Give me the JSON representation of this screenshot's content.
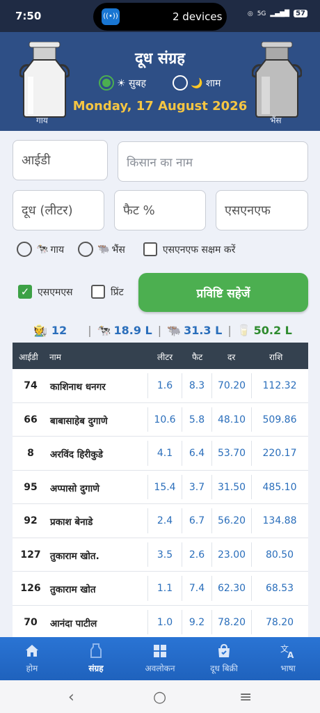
{
  "status_bar": {
    "time": "7:50",
    "devices": "2 devices",
    "battery": "57",
    "net": "5G"
  },
  "header": {
    "title": "दूध संग्रह",
    "left_can_label": "गाय",
    "right_can_label": "भैंस",
    "shift_morning": "☀ सुबह",
    "shift_evening": "🌙 शाम",
    "selected_shift": "morning",
    "date": "Monday, 17 August 2026"
  },
  "form": {
    "id_placeholder": "आईडी",
    "farmer_name_placeholder": "किसान का नाम",
    "milk_placeholder": "दूध (लीटर)",
    "fat_placeholder": "फैट %",
    "snf_placeholder": "एसएनएफ",
    "cow_label": "गाय",
    "buffalo_label": "भैंस",
    "enable_snf_label": "एसएनएफ सक्षम करें",
    "sms_label": "एसएमएस",
    "sms_checked": true,
    "print_label": "प्रिंट",
    "print_checked": false,
    "save_button": "प्रविष्टि सहेजें"
  },
  "summary": {
    "farmers": "12",
    "cow_liters": "18.9 L",
    "buffalo_liters": "31.3 L",
    "total_liters": "50.2 L"
  },
  "table": {
    "headers": {
      "id": "आईडी",
      "name": "नाम",
      "liters": "लीटर",
      "fat": "फैट",
      "rate": "दर",
      "amount": "राशि"
    },
    "rows": [
      {
        "id": "74",
        "name": "काशिनाथ धनगर",
        "liters": "1.6",
        "fat": "8.3",
        "rate": "70.20",
        "amount": "112.32"
      },
      {
        "id": "66",
        "name": "बाबासाहेब दुगाणे",
        "liters": "10.6",
        "fat": "5.8",
        "rate": "48.10",
        "amount": "509.86"
      },
      {
        "id": "8",
        "name": "अरविंद हिरीकुडे",
        "liters": "4.1",
        "fat": "6.4",
        "rate": "53.70",
        "amount": "220.17"
      },
      {
        "id": "95",
        "name": "अप्पासो दुगाणे",
        "liters": "15.4",
        "fat": "3.7",
        "rate": "31.50",
        "amount": "485.10"
      },
      {
        "id": "92",
        "name": "प्रकाश बेनाडे",
        "liters": "2.4",
        "fat": "6.7",
        "rate": "56.20",
        "amount": "134.88"
      },
      {
        "id": "127",
        "name": "तुकाराम खोत.",
        "liters": "3.5",
        "fat": "2.6",
        "rate": "23.00",
        "amount": "80.50"
      },
      {
        "id": "126",
        "name": "तुकाराम खोत",
        "liters": "1.1",
        "fat": "7.4",
        "rate": "62.30",
        "amount": "68.53"
      },
      {
        "id": "70",
        "name": "आनंदा पाटील",
        "liters": "1.0",
        "fat": "9.2",
        "rate": "78.20",
        "amount": "78.20"
      }
    ]
  },
  "bottom_nav": {
    "home": "होम",
    "collection": "संग्रह",
    "overview": "अवलोकन",
    "milk_sale": "दूध बिक्री",
    "language": "भाषा",
    "active": "collection"
  },
  "colors": {
    "header_bg": "#2e4f86",
    "accent_green": "#4caf50",
    "date_yellow": "#f6c642",
    "value_blue": "#2a6ebb",
    "summary_green": "#2e8b2e"
  }
}
